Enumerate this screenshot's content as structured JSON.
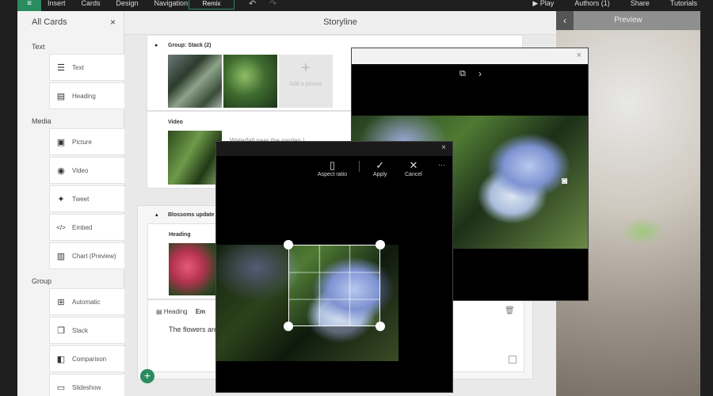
{
  "topbar": {
    "brand_glyph": "≡",
    "menu": [
      "Insert",
      "Cards",
      "Design",
      "Navigation"
    ],
    "remix_label": "Remix",
    "undo_glyph": "↶",
    "redo_glyph": "↷",
    "right": [
      "▶ Play",
      "Authors (1)",
      "Share",
      "Tutorials"
    ]
  },
  "left_panel": {
    "title": "All Cards",
    "close_glyph": "×",
    "sections": [
      {
        "title": "Text",
        "items": [
          {
            "icon": "text-icon",
            "glyph": "☰",
            "label": "Text"
          },
          {
            "icon": "heading-icon",
            "glyph": "▤",
            "label": "Heading"
          }
        ]
      },
      {
        "title": "Media",
        "items": [
          {
            "icon": "picture-icon",
            "glyph": "▣",
            "label": "Picture"
          },
          {
            "icon": "video-icon",
            "glyph": "◉",
            "label": "Video"
          },
          {
            "icon": "tweet-icon",
            "glyph": "✦",
            "label": "Tweet"
          },
          {
            "icon": "embed-icon",
            "glyph": "</>",
            "label": "Embed"
          },
          {
            "icon": "chart-icon",
            "glyph": "▥",
            "label": "Chart (Preview)"
          }
        ]
      },
      {
        "title": "Group",
        "items": [
          {
            "icon": "automatic-icon",
            "glyph": "⊞",
            "label": "Automatic"
          },
          {
            "icon": "stack-icon",
            "glyph": "❐",
            "label": "Stack"
          },
          {
            "icon": "comparison-icon",
            "glyph": "◧",
            "label": "Comparison"
          },
          {
            "icon": "slideshow-icon",
            "glyph": "▭",
            "label": "Slideshow"
          }
        ]
      }
    ]
  },
  "storyline": {
    "title": "Storyline",
    "group_stack_label": "Group: Stack (2)",
    "add_picture_label": "Add a picture",
    "add_picture_glyph": "+",
    "video_label": "Video",
    "video_caption": "Waterfall near the garden !",
    "section_title": "Blossoms update",
    "heading_label": "Heading",
    "editor_tab_heading": "Heading",
    "editor_tab_emphasis": "Em",
    "body_text": "The flowers are b",
    "add_glyph": "+",
    "delete_glyph": "🗑",
    "expand_glyph": "▸",
    "collapse_glyph": "▴"
  },
  "dialog_large": {
    "close_glyph": "×",
    "camera_glyph": "⧉",
    "next_glyph": "›",
    "camera2_glyph": "◙"
  },
  "crop_dialog": {
    "close_glyph": "×",
    "tools": [
      {
        "glyph": "▯",
        "label": "Aspect ratio"
      },
      {
        "glyph": "✓",
        "label": "Apply"
      },
      {
        "glyph": "✕",
        "label": "Cancel"
      }
    ],
    "more_glyph": "···"
  },
  "preview": {
    "title": "Preview",
    "back_glyph": "‹"
  },
  "colors": {
    "accent": "#2a8b5f",
    "chrome": "#1f1f1f"
  }
}
